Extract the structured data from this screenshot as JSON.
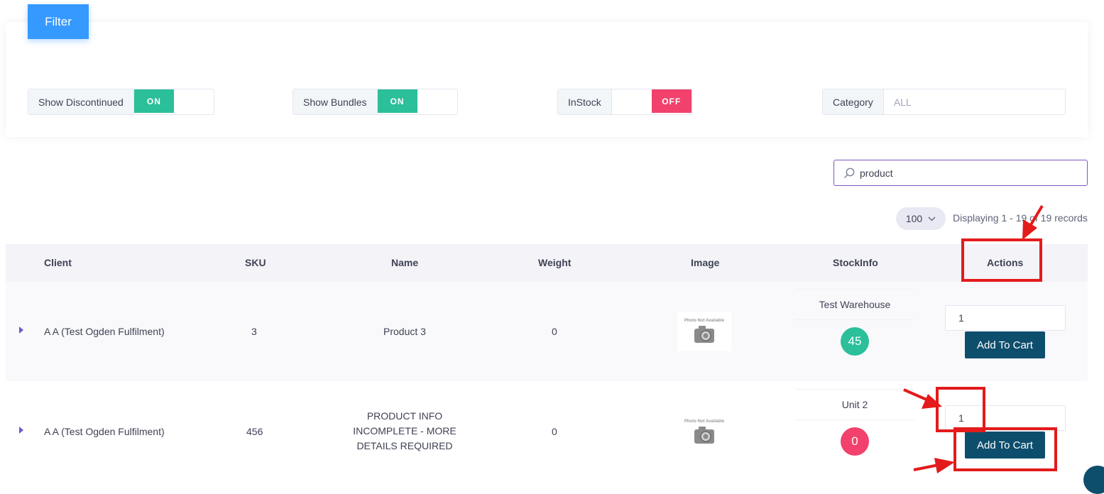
{
  "filter": {
    "button_label": "Filter",
    "show_discontinued": {
      "label": "Show Discontinued",
      "state": "ON"
    },
    "show_bundles": {
      "label": "Show Bundles",
      "state": "ON"
    },
    "instock": {
      "label": "InStock",
      "state": "OFF"
    },
    "category": {
      "label": "Category",
      "value": "ALL"
    }
  },
  "search": {
    "value": "product",
    "icon": "search-icon"
  },
  "pagination": {
    "page_size": "100",
    "records_text": "Displaying 1 - 19 of 19 records"
  },
  "table": {
    "columns": [
      "Client",
      "SKU",
      "Name",
      "Weight",
      "Image",
      "StockInfo",
      "Actions"
    ],
    "rows": [
      {
        "client": "A A (Test Ogden Fulfilment)",
        "sku": "3",
        "name": "Product 3",
        "weight": "0",
        "image_text": "Photo Not Available",
        "warehouse": "Test Warehouse",
        "stock": "45",
        "qty": "1",
        "action_label": "Add To Cart"
      },
      {
        "client": "A A (Test Ogden Fulfilment)",
        "sku": "456",
        "name_lines": [
          "PRODUCT INFO",
          "INCOMPLETE - MORE",
          "DETAILS REQUIRED"
        ],
        "weight": "0",
        "image_text": "Photo Not Available",
        "warehouse": "Unit 2",
        "stock": "0",
        "qty": "1",
        "action_label": "Add To Cart"
      }
    ]
  },
  "colors": {
    "accent_blue": "#3699ff",
    "on_green": "#2bbf9a",
    "off_red": "#f1416c",
    "button_teal": "#0e4e6d",
    "annotation_red": "#e31b1b"
  }
}
